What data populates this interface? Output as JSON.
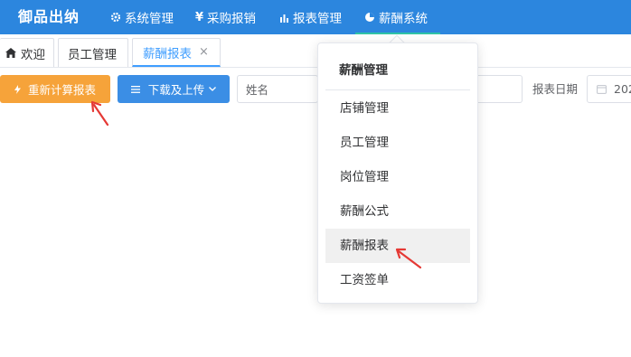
{
  "app": {
    "title": "御品出纳"
  },
  "nav": {
    "items": [
      {
        "label": "系统管理",
        "icon": "gear-icon"
      },
      {
        "label": "采购报销",
        "icon": "yen-icon",
        "glyph": "¥"
      },
      {
        "label": "报表管理",
        "icon": "bar-chart-icon"
      },
      {
        "label": "薪酬系统",
        "icon": "pie-chart-icon",
        "active": true
      }
    ],
    "active_color": "#2fc3a6"
  },
  "tabs": [
    {
      "label": "欢迎",
      "icon": "home-icon"
    },
    {
      "label": "员工管理"
    },
    {
      "label": "薪酬报表",
      "active": true,
      "close_glyph": "×"
    }
  ],
  "toolbar": {
    "recalc_label": "重新计算报表",
    "download_label": "下载及上传",
    "name_placeholder": "姓名",
    "date_label": "报表日期",
    "date_value": "202"
  },
  "dropdown": {
    "title": "薪酬管理",
    "items": [
      "店铺管理",
      "员工管理",
      "岗位管理",
      "薪酬公式",
      "薪酬报表",
      "工资签单"
    ],
    "highlighted": "薪酬报表"
  },
  "colors": {
    "header": "#2c86de",
    "orange_button": "#f6a33a",
    "blue_button": "#3b8ee5",
    "annotation_arrow": "#e53935"
  }
}
